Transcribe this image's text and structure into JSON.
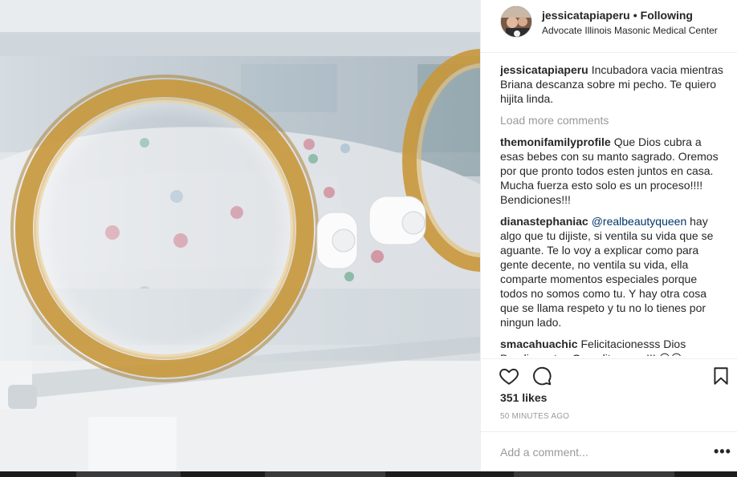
{
  "post": {
    "username": "jessicatapiaperu",
    "separator": "•",
    "follow_status": "Following",
    "location": "Advocate Illinois Masonic Medical Center"
  },
  "caption": {
    "user": "jessicatapiaperu",
    "text": "Incubadora vacia mientras Briana descanza sobre mi pecho. Te quiero hijita linda."
  },
  "load_more": "Load more comments",
  "comments": [
    {
      "user": "themonifamilyprofile",
      "mention": "",
      "text": "Que Dios cubra a esas bebes con su manto sagrado. Oremos por que pronto todos esten juntos en casa. Mucha fuerza esto solo es un proceso!!!! Bendiciones!!!"
    },
    {
      "user": "dianastephaniac",
      "mention": "@realbeautyqueen",
      "text": "hay algo que tu dijiste, si ventila su vida que se aguante. Te lo voy a explicar como para gente decente, no ventila su vida, ella comparte momentos especiales porque todos no somos como tu. Y hay otra cosa que se llama respeto y tu no lo tienes por ningun lado."
    },
    {
      "user": "smacahuachic",
      "mention": "",
      "text": "Felicitacionesss Dios Bendiga a tus Gemelitasss....!!! 😮😮"
    }
  ],
  "likes": "351 likes",
  "timestamp": "50 MINUTES AGO",
  "add_comment": {
    "placeholder": "Add a comment..."
  },
  "more": "•••",
  "icons": {
    "like": "heart-icon",
    "comment": "comment-bubble-icon",
    "save": "bookmark-icon",
    "more": "more-options-icon"
  },
  "colors": {
    "link": "#003569",
    "muted": "#999999",
    "text": "#262626",
    "border": "#efefef"
  }
}
